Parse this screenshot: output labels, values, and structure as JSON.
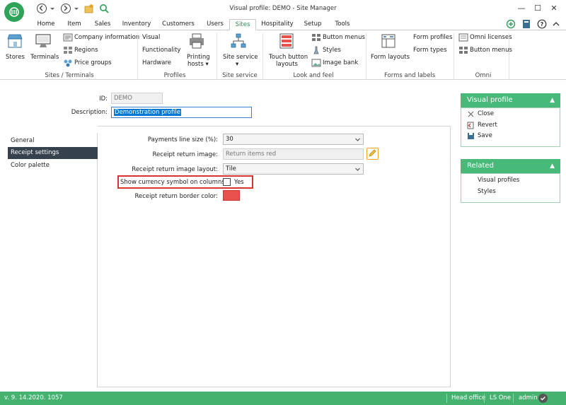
{
  "window": {
    "title": "Visual profile: DEMO - Site Manager",
    "minimize": "—",
    "maximize": "☐",
    "close": "✕"
  },
  "tabs": [
    {
      "label": "Home"
    },
    {
      "label": "Item"
    },
    {
      "label": "Sales"
    },
    {
      "label": "Inventory"
    },
    {
      "label": "Customers"
    },
    {
      "label": "Users"
    },
    {
      "label": "Sites",
      "active": true
    },
    {
      "label": "Hospitality"
    },
    {
      "label": "Setup"
    },
    {
      "label": "Tools"
    }
  ],
  "ribbon": {
    "sites_terminals": {
      "stores": "Stores",
      "terminals": "Terminals",
      "company_information": "Company information",
      "regions": "Regions",
      "price_groups": "Price groups",
      "group_label": "Sites / Terminals"
    },
    "profiles": {
      "visual": "Visual",
      "functionality": "Functionality",
      "hardware": "Hardware",
      "printing_hosts_line1": "Printing",
      "printing_hosts_line2": "hosts ▾",
      "group_label": "Profiles"
    },
    "site_service": {
      "site_service": "Site service",
      "dropdown": "▾",
      "group_label": "Site service"
    },
    "look_and_feel": {
      "touch_line1": "Touch button",
      "touch_line2": "layouts",
      "button_menus": "Button menus",
      "styles": "Styles",
      "image_bank": "Image bank",
      "group_label": "Look and feel"
    },
    "forms_and_labels": {
      "form_layouts": "Form layouts",
      "form_profiles": "Form profiles",
      "form_types": "Form types",
      "group_label": "Forms and labels"
    },
    "omni": {
      "omni_licenses": "Omni licenses",
      "button_menus": "Button menus",
      "group_label": "Omni"
    }
  },
  "header_fields": {
    "id_label": "ID:",
    "id_value": "DEMO",
    "description_label": "Description:",
    "description_value": "Demonstration profile"
  },
  "side_list": [
    {
      "label": "General",
      "selected": false
    },
    {
      "label": "Receipt settings",
      "selected": true
    },
    {
      "label": "Color palette",
      "selected": false
    }
  ],
  "receipt_settings": {
    "payments_line_size_label": "Payments line size (%):",
    "payments_line_size_value": "30",
    "receipt_return_image_label": "Receipt return image:",
    "receipt_return_image_value": "Return items red",
    "receipt_return_image_layout_label": "Receipt return image layout:",
    "receipt_return_image_layout_value": "Tile",
    "show_currency_symbol_label": "Show currency symbol on columns:",
    "show_currency_symbol_checked": false,
    "show_currency_symbol_text": "Yes",
    "receipt_return_border_color_label": "Receipt return border color:",
    "receipt_return_border_color": "#e8504c"
  },
  "visual_profile_panel": {
    "title": "Visual profile",
    "collapse": "▲",
    "actions": [
      {
        "label": "Close"
      },
      {
        "label": "Revert"
      },
      {
        "label": "Save"
      }
    ]
  },
  "related_panel": {
    "title": "Related",
    "collapse": "▲",
    "links": [
      {
        "label": "Visual profiles"
      },
      {
        "label": "Styles"
      }
    ]
  },
  "status_bar": {
    "version": "v. 9. 14.2020. 1057",
    "store": "Head office",
    "product": "LS One",
    "user": "admin"
  },
  "colors": {
    "accent_green": "#45b270",
    "highlight_red": "#d9342b",
    "selected_item": "#35414d"
  }
}
